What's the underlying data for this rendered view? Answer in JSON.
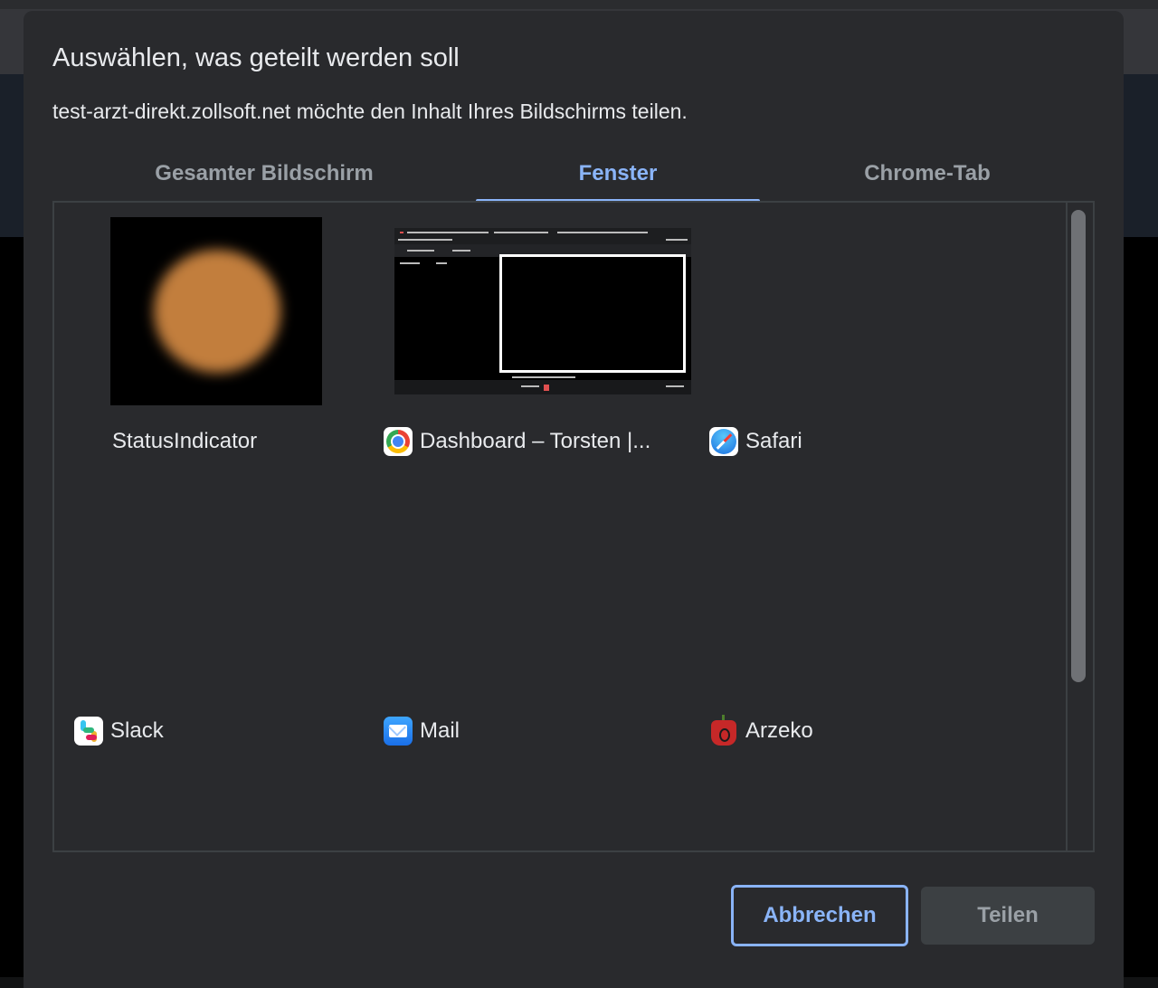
{
  "dialog": {
    "title": "Auswählen, was geteilt werden soll",
    "subtitle": "test-arzt-direkt.zollsoft.net möchte den Inhalt Ihres Bildschirms teilen."
  },
  "tabs": [
    {
      "label": "Gesamter Bildschirm",
      "active": false
    },
    {
      "label": "Fenster",
      "active": true
    },
    {
      "label": "Chrome-Tab",
      "active": false
    }
  ],
  "sources": [
    {
      "label": "StatusIndicator",
      "icon": "none"
    },
    {
      "label": "Dashboard – Torsten |...",
      "icon": "chrome-icon"
    },
    {
      "label": "Safari",
      "icon": "safari-icon"
    },
    {
      "label": "Slack",
      "icon": "slack-icon"
    },
    {
      "label": "Mail",
      "icon": "mail-icon"
    },
    {
      "label": "Arzeko",
      "icon": "arzeko-icon"
    }
  ],
  "buttons": {
    "cancel": "Abbrechen",
    "share": "Teilen"
  },
  "colors": {
    "accent": "#8ab4f8",
    "dialog_bg": "#292a2d",
    "text": "#e8eaed",
    "muted": "#9aa0a6"
  }
}
